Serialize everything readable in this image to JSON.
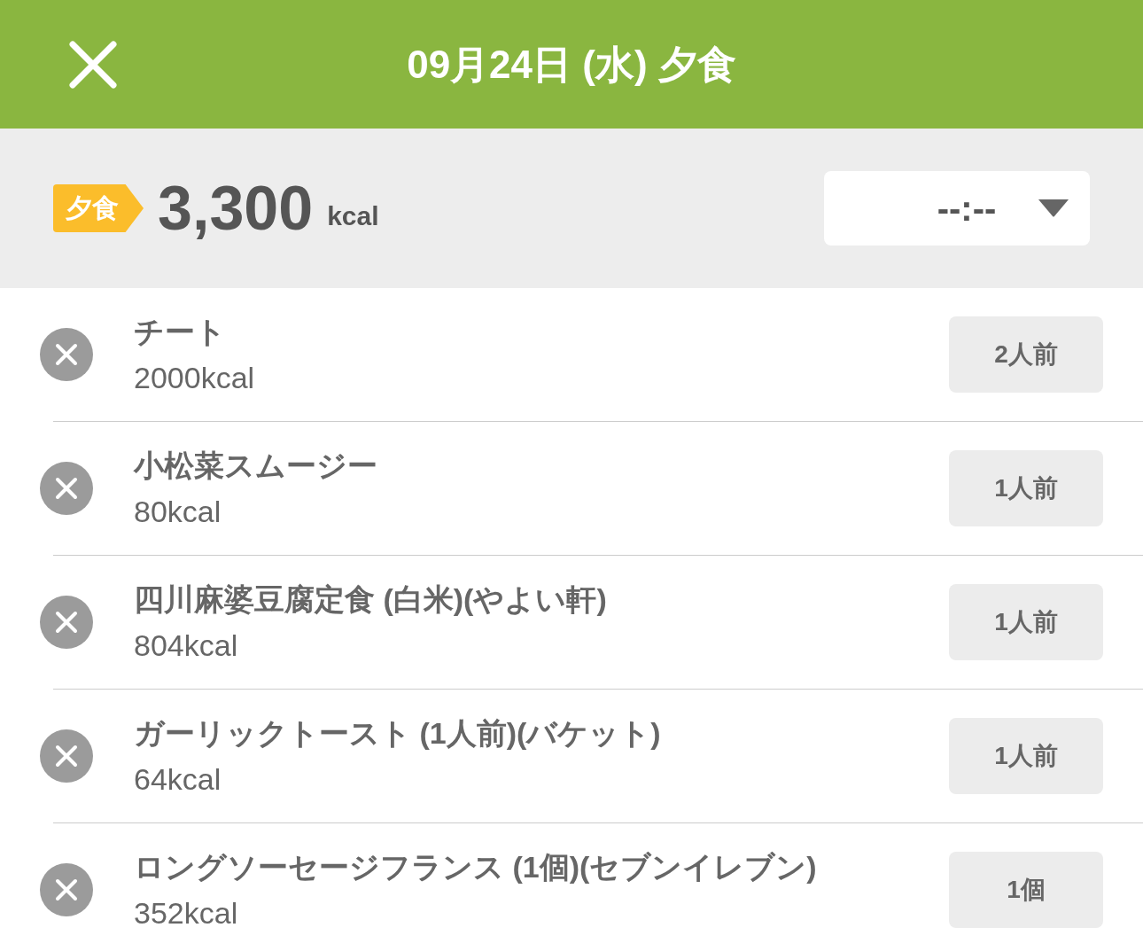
{
  "header": {
    "title": "09月24日 (水) 夕食"
  },
  "summary": {
    "meal_badge": "夕食",
    "total": "3,300",
    "unit": "kcal",
    "time_select": {
      "value": "--:--"
    }
  },
  "items": [
    {
      "name": "チート",
      "calories": "2000kcal",
      "portion": "2人前"
    },
    {
      "name": "小松菜スムージー",
      "calories": "80kcal",
      "portion": "1人前"
    },
    {
      "name": "四川麻婆豆腐定食 (白米)(やよい軒)",
      "calories": "804kcal",
      "portion": "1人前"
    },
    {
      "name": "ガーリックトースト (1人前)(バケット)",
      "calories": "64kcal",
      "portion": "1人前"
    },
    {
      "name": "ロングソーセージフランス (1個)(セブンイレブン)",
      "calories": "352kcal",
      "portion": "1個"
    }
  ]
}
